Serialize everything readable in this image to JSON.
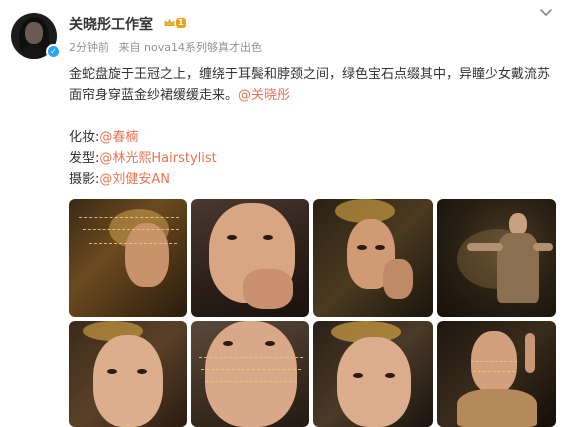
{
  "post": {
    "author": "关晓彤工作室",
    "vip_level": "1",
    "time": "2分钟前",
    "source": "来自 nova14系列够真才出色",
    "text_main": "金蛇盘旋于王冠之上，缠绕于耳鬓和脖颈之间，绿色宝石点缀其中，异瞳少女戴流苏面帘身穿蓝金纱裙缓缓走来。",
    "mention_main": "@关晓彤",
    "credits": [
      {
        "label": "化妆:",
        "mention": "@春楠"
      },
      {
        "label": "发型:",
        "mention": "@林光熙Hairstylist"
      },
      {
        "label": "摄影:",
        "mention": "@刘健安AN"
      }
    ]
  },
  "icons": {
    "verified": "verified-badge-icon",
    "vip": "crown-icon",
    "more": "chevron-down-icon"
  },
  "colors": {
    "link": "#eb7350",
    "meta": "#939393",
    "verified": "#2aa4f4",
    "vip": "#e8a21b"
  },
  "photos": [
    {
      "name": "photo-1"
    },
    {
      "name": "photo-2"
    },
    {
      "name": "photo-3"
    },
    {
      "name": "photo-4"
    },
    {
      "name": "photo-5"
    },
    {
      "name": "photo-6"
    },
    {
      "name": "photo-7"
    },
    {
      "name": "photo-8"
    }
  ]
}
